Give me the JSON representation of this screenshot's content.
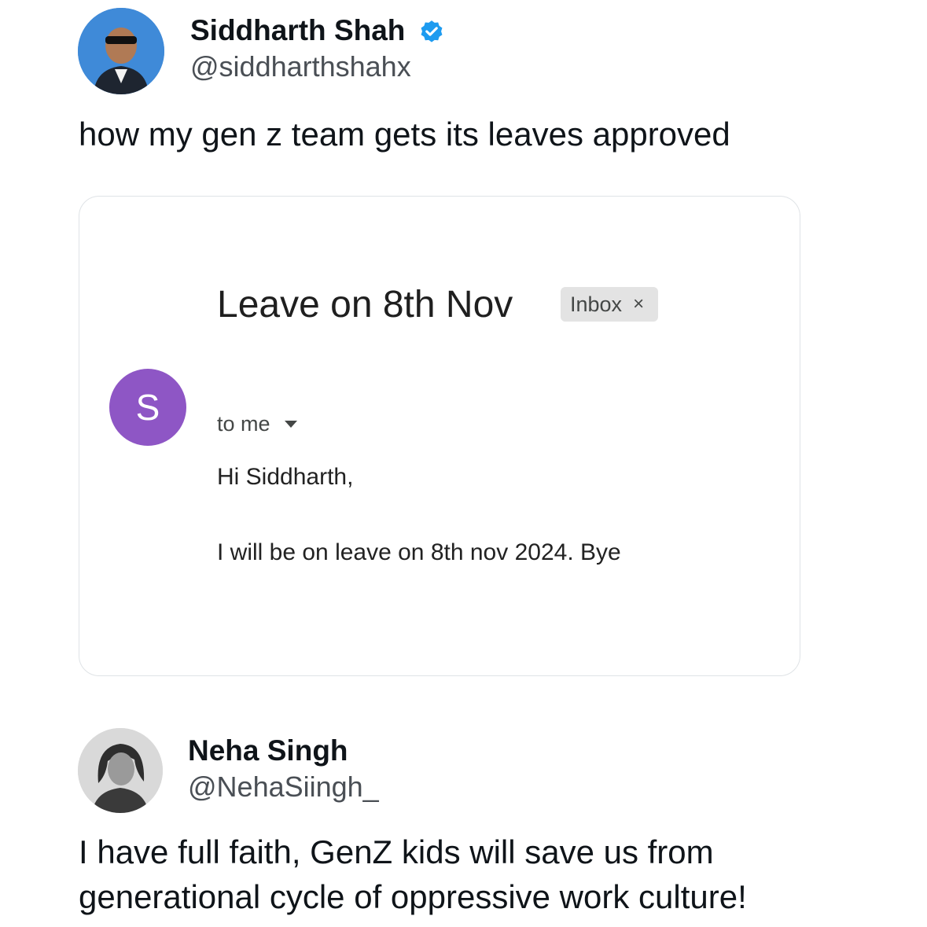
{
  "post": {
    "author_name": "Siddharth Shah",
    "author_handle": "@siddharthshahx",
    "text": "how my gen z team gets its leaves approved",
    "verified_icon": "verified-badge-icon",
    "verified_color": "#1d9bf0"
  },
  "email": {
    "subject": "Leave on 8th Nov",
    "label": "Inbox",
    "label_remove": "×",
    "sender_initial": "S",
    "sender_color": "#8e56c5",
    "recipient": "to me",
    "greeting": "Hi Siddharth,",
    "body": "I will be on leave on 8th nov 2024. Bye"
  },
  "reply": {
    "author_name": "Neha Singh",
    "author_handle": "@NehaSiingh_",
    "text_line1": "I have full faith, GenZ kids will save us from",
    "text_line2": "generational cycle of oppressive work culture!"
  }
}
